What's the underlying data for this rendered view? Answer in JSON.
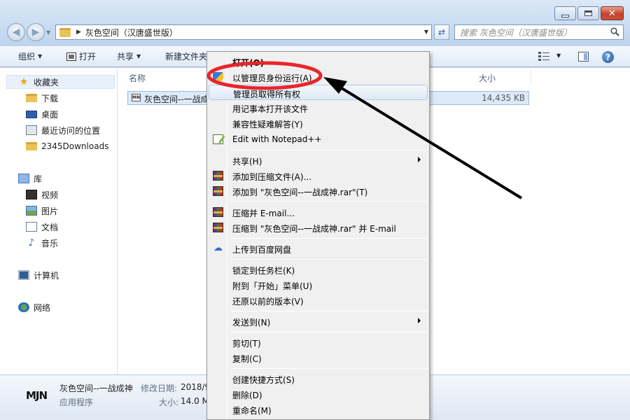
{
  "window": {
    "address": "灰色空间（汉唐盛世版）",
    "search_placeholder": "搜索 灰色空间（汉唐盛世版）",
    "close_glyph": "✕"
  },
  "toolbar": {
    "organize": "组织",
    "open": "打开",
    "share": "共享",
    "new_folder": "新建文件夹"
  },
  "nav": {
    "favorites": "收藏夹",
    "downloads": "下载",
    "desktop": "桌面",
    "recent": "最近访问的位置",
    "downloads_2345": "2345Downloads",
    "libraries": "库",
    "videos": "视频",
    "pictures": "图片",
    "documents": "文档",
    "music": "音乐",
    "computer": "计算机",
    "network": "网络"
  },
  "files": {
    "col_name": "名称",
    "col_size": "大小",
    "rows": [
      {
        "name": "灰色空间--一战成",
        "size": "14,435 KB",
        "icon_text": "MN"
      }
    ]
  },
  "details": {
    "logo": "MJN",
    "name": "灰色空间--一战成神",
    "modified_label": "修改日期:",
    "modified_value": "2018/9",
    "type": "应用程序",
    "size_label": "大小:",
    "size_value": "14.0 M"
  },
  "context_menu": {
    "items": [
      {
        "label": "打开(O)",
        "icon": "none",
        "bold": true
      },
      {
        "label": "以管理员身份运行(A)",
        "icon": "shield-icon"
      },
      {
        "label": "管理员取得所有权",
        "icon": "none"
      },
      {
        "label": "用记事本打开该文件",
        "icon": "none"
      },
      {
        "label": "兼容性疑难解答(Y)",
        "icon": "none"
      },
      {
        "label": "Edit with Notepad++",
        "icon": "notepadpp-icon"
      },
      {
        "label": "共享(H)",
        "icon": "none",
        "submenu": true
      },
      {
        "label": "添加到压缩文件(A)...",
        "icon": "winrar-icon"
      },
      {
        "label": "添加到 \"灰色空间--一战成神.rar\"(T)",
        "icon": "winrar-icon"
      },
      {
        "label": "压缩并 E-mail...",
        "icon": "winrar-icon"
      },
      {
        "label": "压缩到 \"灰色空间--一战成神.rar\" 并 E-mail",
        "icon": "winrar-icon"
      },
      {
        "label": "上传到百度网盘",
        "icon": "baidu-netdisk-icon"
      },
      {
        "label": "锁定到任务栏(K)",
        "icon": "none"
      },
      {
        "label": "附到「开始」菜单(U)",
        "icon": "none"
      },
      {
        "label": "还原以前的版本(V)",
        "icon": "none"
      },
      {
        "label": "发送到(N)",
        "icon": "none",
        "submenu": true
      },
      {
        "label": "剪切(T)",
        "icon": "none"
      },
      {
        "label": "复制(C)",
        "icon": "none"
      },
      {
        "label": "创建快捷方式(S)",
        "icon": "none"
      },
      {
        "label": "删除(D)",
        "icon": "none"
      },
      {
        "label": "重命名(M)",
        "icon": "none"
      }
    ]
  },
  "annotation": {
    "color": "#e8262c",
    "target": "以管理员身份运行(A)"
  }
}
